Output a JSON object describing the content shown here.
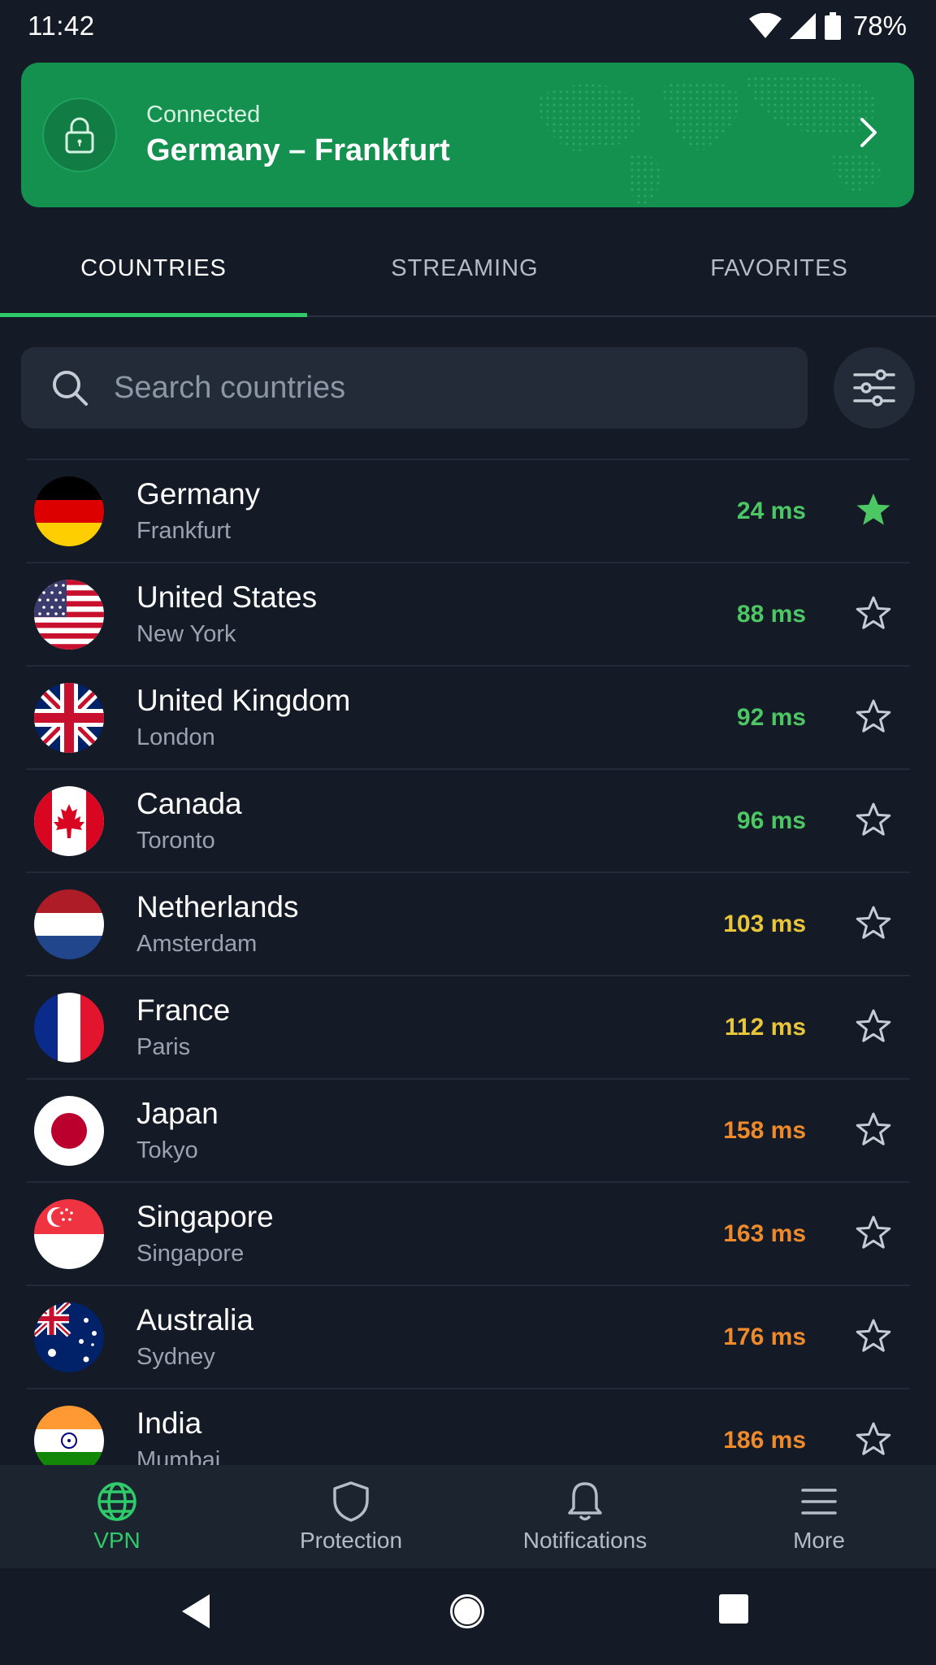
{
  "status_bar": {
    "time": "11:42",
    "battery": "78%"
  },
  "banner": {
    "status": "Connected",
    "location": "Germany – Frankfurt"
  },
  "tabs": [
    {
      "label": "COUNTRIES"
    },
    {
      "label": "STREAMING"
    },
    {
      "label": "FAVORITES"
    }
  ],
  "search": {
    "placeholder": "Search countries"
  },
  "servers": [
    {
      "country": "Germany",
      "city": "Frankfurt",
      "ping": "24 ms"
    },
    {
      "country": "United States",
      "city": "New York",
      "ping": "88 ms"
    },
    {
      "country": "United Kingdom",
      "city": "London",
      "ping": "92 ms"
    },
    {
      "country": "Canada",
      "city": "Toronto",
      "ping": "96 ms"
    },
    {
      "country": "Netherlands",
      "city": "Amsterdam",
      "ping": "103 ms"
    },
    {
      "country": "France",
      "city": "Paris",
      "ping": "112 ms"
    },
    {
      "country": "Japan",
      "city": "Tokyo",
      "ping": "158 ms"
    },
    {
      "country": "Singapore",
      "city": "Singapore",
      "ping": "163 ms"
    },
    {
      "country": "Australia",
      "city": "Sydney",
      "ping": "176 ms"
    },
    {
      "country": "India",
      "city": "Mumbai",
      "ping": "186 ms"
    }
  ],
  "ping_colors": {
    "good": "#4cc764",
    "medium": "#e9c53a",
    "slow": "#ee8a2c"
  },
  "bottom_nav": [
    {
      "label": "VPN",
      "icon": "globe-icon"
    },
    {
      "label": "Protection",
      "icon": "shield-icon"
    },
    {
      "label": "Notifications",
      "icon": "bell-icon"
    },
    {
      "label": "More",
      "icon": "menu-icon"
    }
  ]
}
